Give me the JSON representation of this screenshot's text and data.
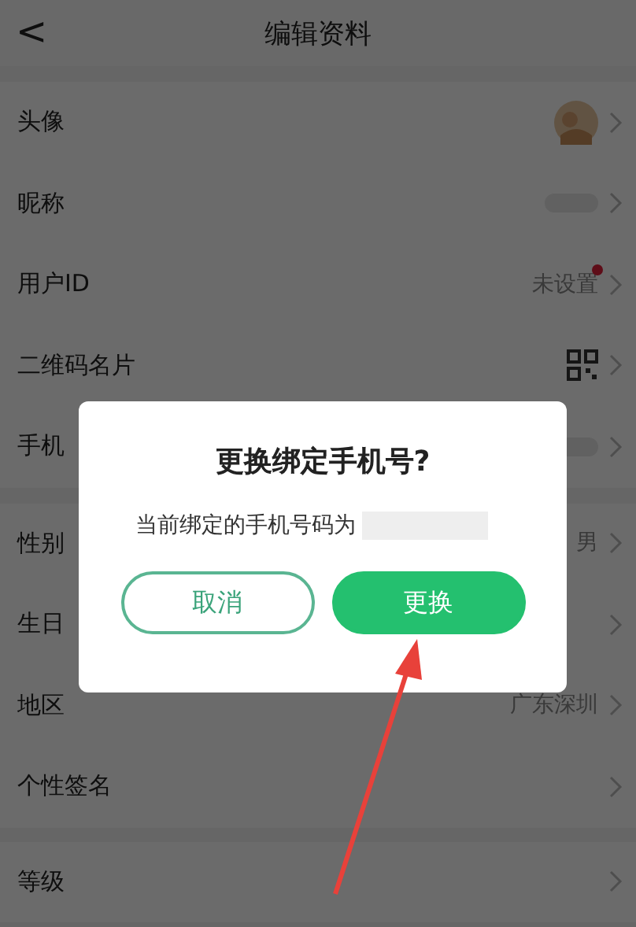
{
  "header": {
    "back": "<",
    "title": "编辑资料"
  },
  "sections": [
    {
      "rows": [
        {
          "label": "头像",
          "kind": "avatar",
          "dot": false
        },
        {
          "label": "昵称",
          "kind": "hidden",
          "dot": false
        },
        {
          "label": "用户ID",
          "kind": "text",
          "value": "未设置",
          "dot": true
        },
        {
          "label": "二维码名片",
          "kind": "qr",
          "dot": false
        },
        {
          "label": "手机",
          "kind": "hidden",
          "dot": false
        }
      ]
    },
    {
      "rows": [
        {
          "label": "性别",
          "kind": "text",
          "value": "男",
          "dot": false
        },
        {
          "label": "生日",
          "kind": "plain",
          "dot": false
        },
        {
          "label": "地区",
          "kind": "text",
          "value": "广东深圳",
          "dot": false
        },
        {
          "label": "个性签名",
          "kind": "plain",
          "dot": false
        }
      ]
    },
    {
      "rows": [
        {
          "label": "等级",
          "kind": "plain",
          "dot": false
        }
      ]
    }
  ],
  "dialog": {
    "title": "更换绑定手机号?",
    "message": "当前绑定的手机号码为",
    "cancel": "取消",
    "confirm": "更换"
  },
  "annotation": {
    "kind": "arrow"
  }
}
